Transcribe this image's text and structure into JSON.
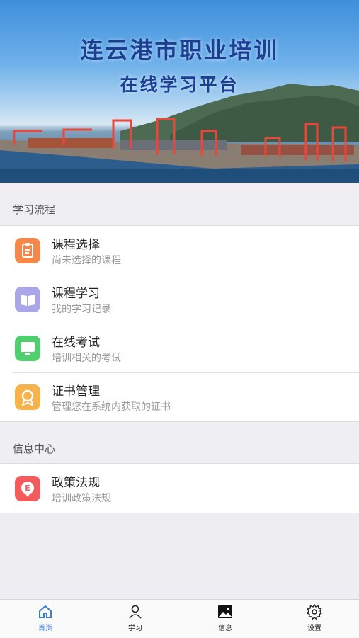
{
  "banner": {
    "title": "连云港市职业培训",
    "subtitle": "在线学习平台"
  },
  "sections": [
    {
      "header": "学习流程",
      "items": [
        {
          "title": "课程选择",
          "subtitle": "尚未选择的课程",
          "icon": "clipboard-icon",
          "color": "#f5874a"
        },
        {
          "title": "课程学习",
          "subtitle": "我的学习记录",
          "icon": "book-icon",
          "color": "#a9a6ea"
        },
        {
          "title": "在线考试",
          "subtitle": "培训相关的考试",
          "icon": "monitor-icon",
          "color": "#4fcf6e"
        },
        {
          "title": "证书管理",
          "subtitle": "管理您在系统内获取的证书",
          "icon": "certificate-icon",
          "color": "#f7b24a"
        }
      ]
    },
    {
      "header": "信息中心",
      "items": [
        {
          "title": "政策法规",
          "subtitle": "培训政策法规",
          "icon": "policy-icon",
          "color": "#f25c5c"
        }
      ]
    }
  ],
  "tabbar": {
    "items": [
      {
        "label": "首页",
        "icon": "home-icon",
        "active": true
      },
      {
        "label": "学习",
        "icon": "user-icon",
        "active": false
      },
      {
        "label": "信息",
        "icon": "image-icon",
        "active": false
      },
      {
        "label": "设置",
        "icon": "gear-icon",
        "active": false
      }
    ],
    "active_color": "#3a7bd5"
  }
}
